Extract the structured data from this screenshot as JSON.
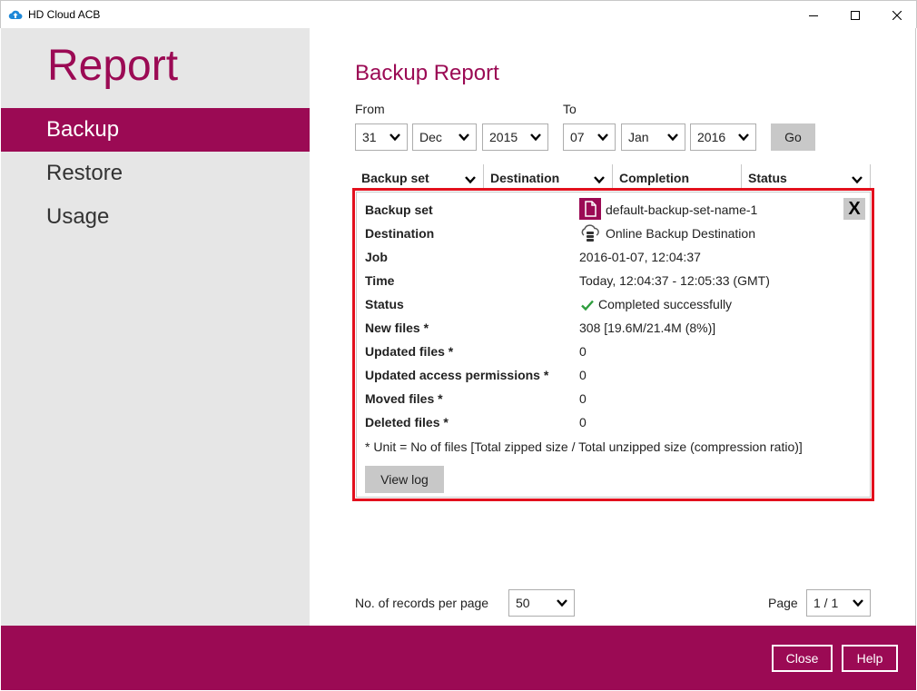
{
  "window": {
    "title": "HD Cloud ACB",
    "icon": "cloud-icon"
  },
  "sidebar": {
    "heading": "Report",
    "items": [
      {
        "label": "Backup",
        "active": true
      },
      {
        "label": "Restore",
        "active": false
      },
      {
        "label": "Usage",
        "active": false
      }
    ]
  },
  "main": {
    "title": "Backup Report",
    "from_label": "From",
    "to_label": "To",
    "from": {
      "day": "31",
      "month": "Dec",
      "year": "2015"
    },
    "to": {
      "day": "07",
      "month": "Jan",
      "year": "2016"
    },
    "go_label": "Go",
    "columns": [
      "Backup set",
      "Destination",
      "Completion",
      "Status"
    ]
  },
  "detail": {
    "rows": [
      {
        "label": "Backup set",
        "value": "default-backup-set-name-1",
        "icon": "document-icon"
      },
      {
        "label": "Destination",
        "value": "Online Backup Destination",
        "icon": "cloud-storage-icon"
      },
      {
        "label": "Job",
        "value": "2016-01-07, 12:04:37"
      },
      {
        "label": "Time",
        "value": "Today, 12:04:37 - 12:05:33 (GMT)"
      },
      {
        "label": "Status",
        "value": "Completed successfully",
        "icon": "check-icon"
      },
      {
        "label": "New files *",
        "value": "308 [19.6M/21.4M (8%)]"
      },
      {
        "label": "Updated files *",
        "value": "0"
      },
      {
        "label": "Updated access permissions *",
        "value": "0"
      },
      {
        "label": "Moved files *",
        "value": "0"
      },
      {
        "label": "Deleted files *",
        "value": "0"
      }
    ],
    "close_label": "X",
    "unit_note": "* Unit = No of files [Total zipped size / Total unzipped size (compression ratio)]",
    "view_log_label": "View log"
  },
  "pagination": {
    "records_label": "No. of records per page",
    "records_value": "50",
    "page_label": "Page",
    "page_value": "1 / 1"
  },
  "footer": {
    "close_label": "Close",
    "help_label": "Help"
  },
  "colors": {
    "accent": "#9b0a54",
    "highlight": "#e3101d",
    "sidebar_bg": "#e6e6e6",
    "button_gray": "#c8c8c8"
  }
}
